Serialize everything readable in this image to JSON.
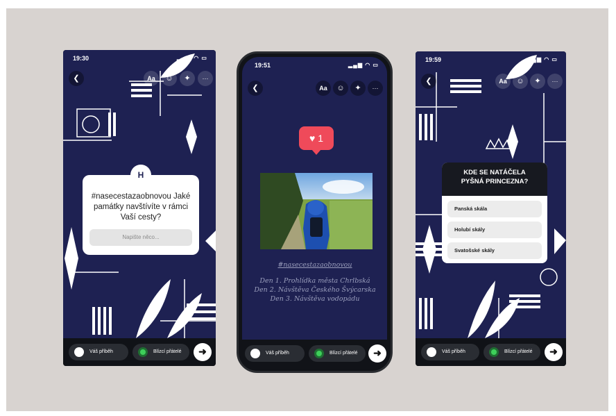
{
  "phones": [
    {
      "time": "19:30",
      "status_icons": "▂▄▆ ◠ ▭",
      "toolbar": {
        "back_icon": "chevron-left-icon",
        "text_label": "Aa",
        "sticker_icon": "sticker-icon",
        "effects_icon": "sparkles-icon",
        "more_label": "···"
      },
      "logo_label": "H",
      "question": "#nasecestazaobnovou Jaké památky navštívíte v rámci Vaší cesty?",
      "answer_placeholder": "Napište něco...",
      "bottom": {
        "story_label": "Váš příběh",
        "friends_label": "Blízcí přátelé",
        "send_icon": "arrow-right-icon",
        "send_label": "➜"
      }
    },
    {
      "time": "19:51",
      "status_icons": "▂▄▆ ◠ ▭",
      "toolbar": {
        "back_icon": "chevron-left-icon",
        "text_label": "Aa",
        "sticker_icon": "sticker-icon",
        "effects_icon": "sparkles-icon",
        "more_label": "···"
      },
      "like_label": "♥ 1",
      "hashtag": "#nasecestazaobnovou",
      "itinerary": [
        "Den 1. Prohlídka města Chrlbská",
        "Den 2. Návštěva Českého Švýcarska",
        "Den 3. Návštěva vodopádu"
      ],
      "bottom": {
        "story_label": "Váš příběh",
        "friends_label": "Blízcí přátelé",
        "send_icon": "arrow-right-icon",
        "send_label": "➜"
      }
    },
    {
      "time": "19:59",
      "status_icons": "▂▄▆ ◠ ▭",
      "toolbar": {
        "back_icon": "chevron-left-icon",
        "text_label": "Aa",
        "sticker_icon": "sticker-icon",
        "effects_icon": "sparkles-icon",
        "more_label": "···"
      },
      "quiz_question": "KDE SE NATÁČELA PYŠNÁ PRINCEZNA?",
      "options": [
        "Panská skála",
        "Holubí skály",
        "Svatošské skály"
      ],
      "bottom": {
        "story_label": "Váš příběh",
        "friends_label": "Blízcí přátelé",
        "send_icon": "arrow-right-icon",
        "send_label": "➜"
      }
    }
  ],
  "colors": {
    "story_bg": "#1e2152",
    "like_red": "#ef4a5a",
    "background": "#d8d3d0"
  }
}
